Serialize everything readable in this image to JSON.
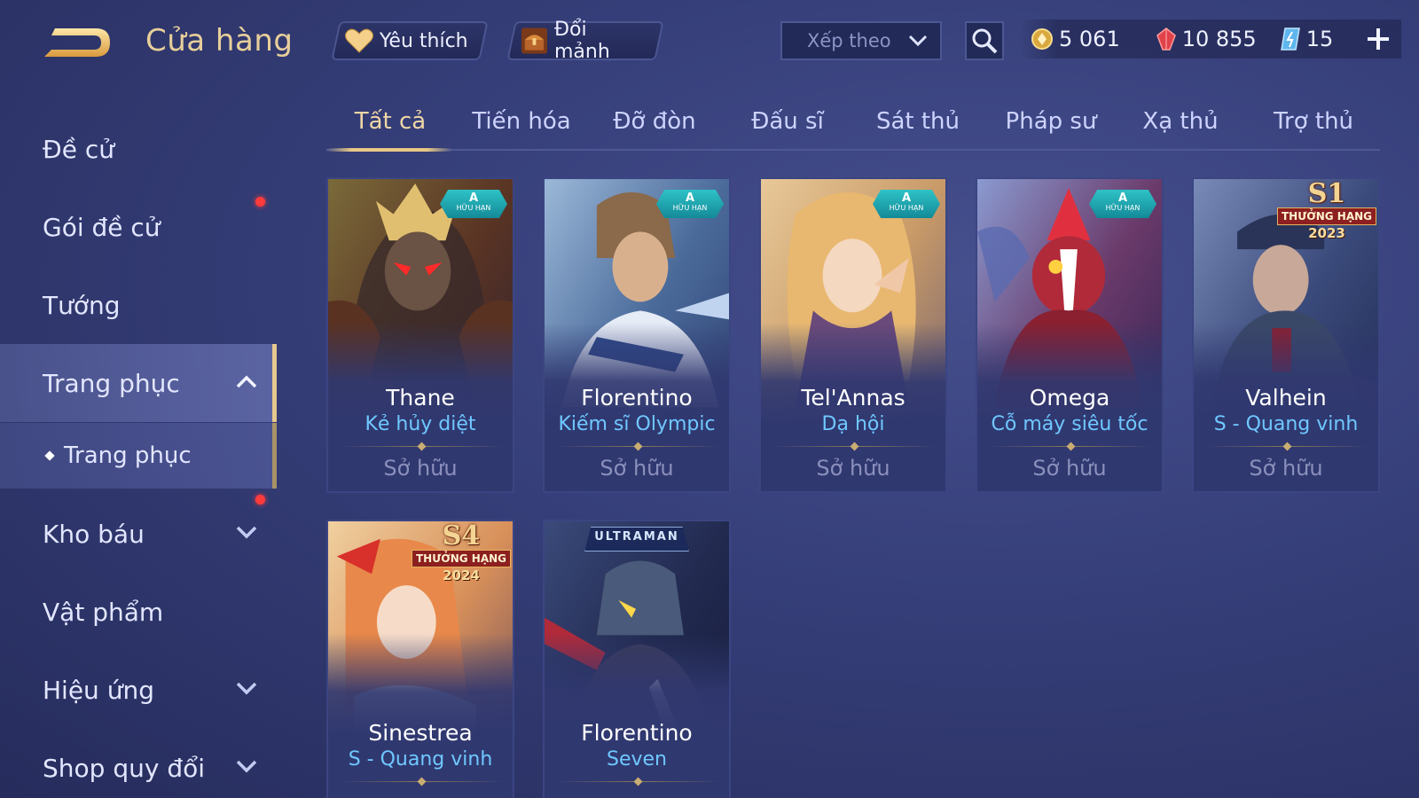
{
  "header": {
    "title": "Cửa hàng",
    "favorites_label": "Yêu thích",
    "exchange_label": "Đổi mảnh",
    "sort_label": "Xếp theo"
  },
  "currency": {
    "gold": "5 061",
    "ruby": "10 855",
    "voucher": "15"
  },
  "sidebar": {
    "items": [
      {
        "label": "Đề cử"
      },
      {
        "label": "Gói đề cử"
      },
      {
        "label": "Tướng"
      },
      {
        "label": "Trang phục"
      },
      {
        "label": "Trang phục"
      },
      {
        "label": "Kho báu"
      },
      {
        "label": "Vật phẩm"
      },
      {
        "label": "Hiệu ứng"
      },
      {
        "label": "Shop quy đổi"
      }
    ]
  },
  "tabs": [
    {
      "label": "Tất cả"
    },
    {
      "label": "Tiến hóa"
    },
    {
      "label": "Đỡ đòn"
    },
    {
      "label": "Đấu sĩ"
    },
    {
      "label": "Sát thủ"
    },
    {
      "label": "Pháp sư"
    },
    {
      "label": "Xạ thủ"
    },
    {
      "label": "Trợ thủ"
    }
  ],
  "cards": [
    {
      "hero": "Thane",
      "skin": "Kẻ hủy diệt",
      "status": "Sở hữu",
      "badge": "a-limited",
      "badge_a": "A",
      "badge_text": "HỮU HẠN"
    },
    {
      "hero": "Florentino",
      "skin": "Kiếm sĩ Olympic",
      "status": "Sở hữu",
      "badge": "a-limited",
      "badge_a": "A",
      "badge_text": "HỮU HẠN"
    },
    {
      "hero": "Tel'Annas",
      "skin": "Dạ hội",
      "status": "Sở hữu",
      "badge": "a-limited",
      "badge_a": "A",
      "badge_text": "HỮU HẠN"
    },
    {
      "hero": "Omega",
      "skin": "Cỗ máy siêu tốc",
      "status": "Sở hữu",
      "badge": "a-limited",
      "badge_a": "A",
      "badge_text": "HỮU HẠN"
    },
    {
      "hero": "Valhein",
      "skin": "S - Quang vinh",
      "status": "Sở hữu",
      "badge": "rank",
      "season": "S1",
      "rank_text": "THƯỞNG HẠNG",
      "year": "2023"
    },
    {
      "hero": "Sinestrea",
      "skin": "S - Quang vinh",
      "badge": "rank",
      "season": "S4",
      "rank_text": "THƯỞNG HẠNG",
      "year": "2024"
    },
    {
      "hero": "Florentino",
      "skin": "Seven",
      "badge": "ultraman",
      "badge_text": "ULTRAMAN"
    }
  ],
  "colors": {
    "accent_gold": "#e7cf9b",
    "skin_name_blue": "#6fc8ff",
    "notification_red": "#ff3b3b"
  }
}
